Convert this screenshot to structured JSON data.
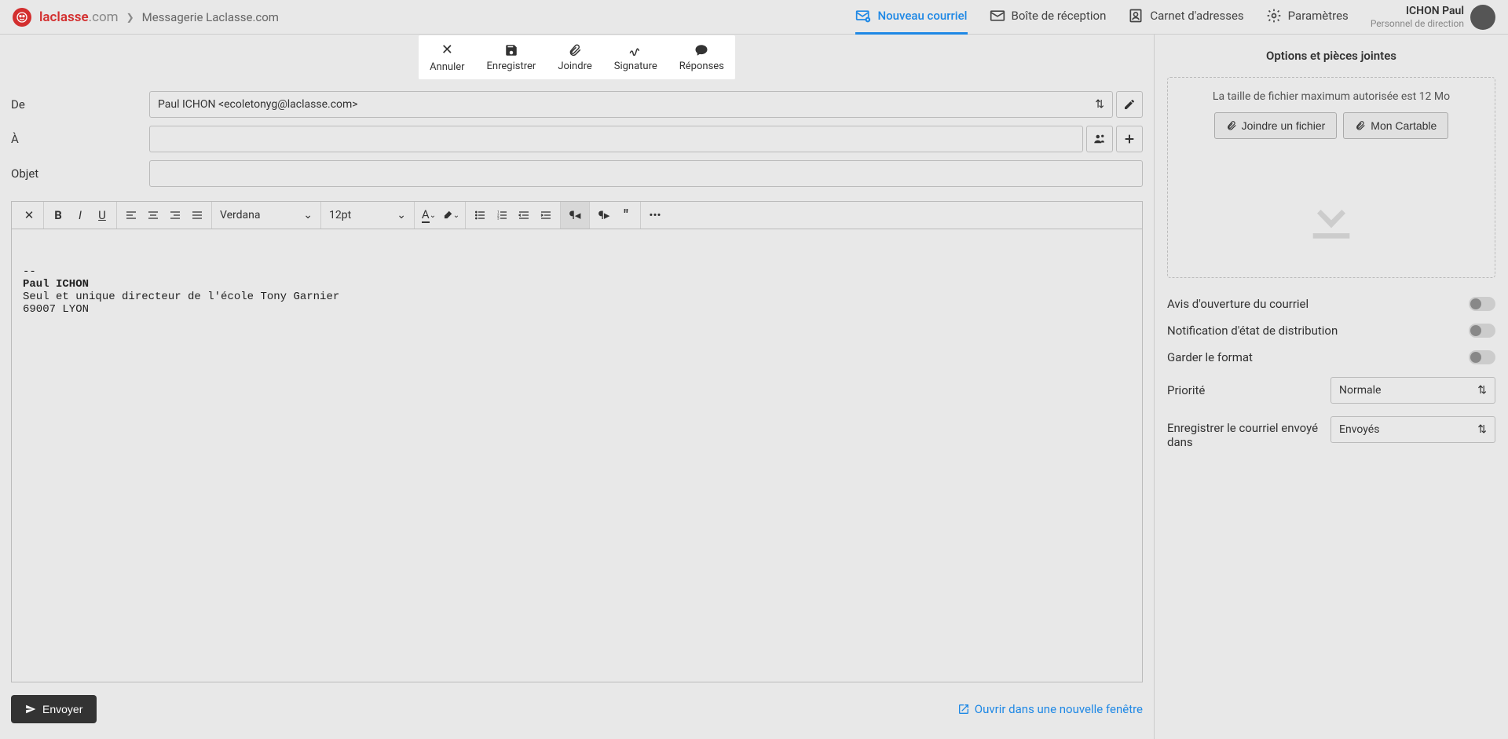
{
  "header": {
    "logo_main": "laclasse",
    "logo_suffix": ".com",
    "breadcrumb": "Messagerie Laclasse.com",
    "nav": {
      "new_mail": "Nouveau courriel",
      "inbox": "Boîte de réception",
      "contacts": "Carnet d'adresses",
      "settings": "Paramètres"
    },
    "user": {
      "name": "ICHON Paul",
      "role": "Personnel de direction"
    }
  },
  "toolbar": {
    "cancel": "Annuler",
    "save": "Enregistrer",
    "attach": "Joindre",
    "signature": "Signature",
    "responses": "Réponses"
  },
  "form": {
    "from_label": "De",
    "from_value": "Paul ICHON <ecoletonyg@laclasse.com>",
    "to_label": "À",
    "subject_label": "Objet"
  },
  "editor": {
    "font": "Verdana",
    "size": "12pt",
    "body_separator": "-- ",
    "body_name": "Paul ICHON",
    "body_line2": "Seul et unique directeur de l'école Tony Garnier",
    "body_line3": "69007 LYON"
  },
  "footer": {
    "send": "Envoyer",
    "open_new": "Ouvrir dans une nouvelle fenêtre"
  },
  "sidebar": {
    "title": "Options et pièces jointes",
    "dropzone_text": "La taille de fichier maximum autorisée est 12 Mo",
    "attach_file": "Joindre un fichier",
    "my_bag": "Mon Cartable",
    "options": {
      "read_receipt": "Avis d'ouverture du courriel",
      "delivery_status": "Notification d'état de distribution",
      "keep_format": "Garder le format",
      "priority_label": "Priorité",
      "priority_value": "Normale",
      "save_in_label": "Enregistrer le courriel envoyé dans",
      "save_in_value": "Envoyés"
    }
  }
}
